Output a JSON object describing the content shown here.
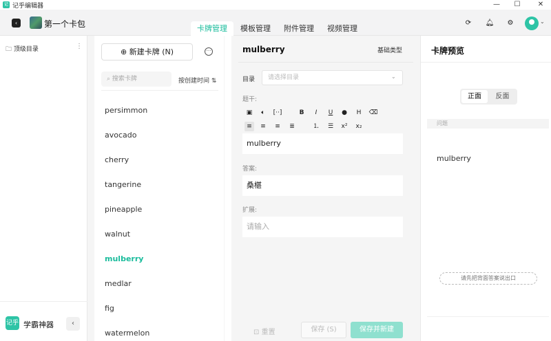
{
  "window": {
    "title": "记乎编辑器",
    "app_icon": "记乎",
    "minimize": "—",
    "maximize": "☐",
    "close": "✕"
  },
  "header": {
    "pack_name": "第一个卡包",
    "tabs": [
      {
        "label": "卡牌管理",
        "active": true
      },
      {
        "label": "模板管理",
        "active": false
      },
      {
        "label": "附件管理",
        "active": false
      },
      {
        "label": "视频管理",
        "active": false
      }
    ]
  },
  "sidebar": {
    "folder_label": "顶级目录",
    "brand_logo": "记乎",
    "brand_name": "学霸神器"
  },
  "cardlist": {
    "new_card_label": "新建卡牌 (N)",
    "search_placeholder": "搜索卡牌",
    "sort_label": "按创建时间 ⇅",
    "items": [
      "persimmon",
      "avocado",
      "cherry",
      "tangerine",
      "pineapple",
      "walnut",
      "mulberry",
      "medlar",
      "fig",
      "watermelon"
    ],
    "active_item": "mulberry"
  },
  "editor": {
    "card_title": "mulberry",
    "type_label": "基础类型",
    "dir_label": "目录",
    "dir_placeholder": "请选择目录",
    "stem_label": "题干:",
    "stem_value": "mulberry",
    "answer_label": "答案:",
    "answer_value": "桑椹",
    "ext_label": "扩展:",
    "ext_placeholder": "请输入",
    "reset_label": "重置",
    "save_label": "保存 (S)",
    "save_new_label": "保存并新建"
  },
  "preview": {
    "title": "卡牌预览",
    "front_label": "正面",
    "back_label": "反面",
    "question_label": "问题",
    "question_text": "mulberry",
    "hint_label": "请先把背面答案说出口"
  },
  "colors": {
    "accent": "#1abc9c",
    "accent_light": "#8fe0cf"
  }
}
